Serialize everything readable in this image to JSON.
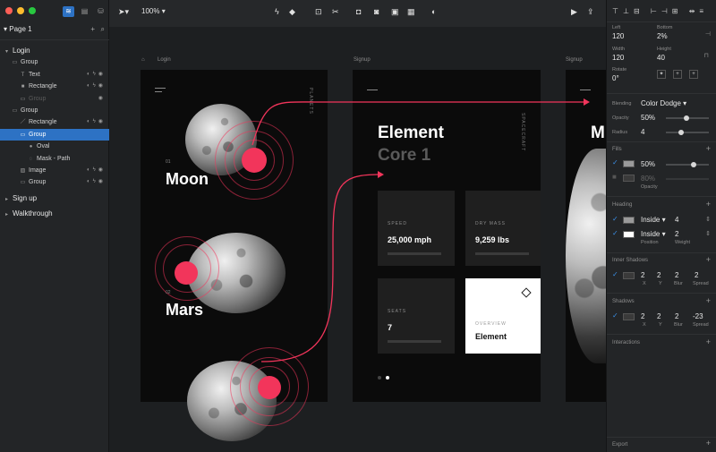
{
  "layers_panel": {
    "page_label": "Page 1",
    "tree": [
      {
        "label": "Login",
        "level": 0,
        "icon": "chevron-down",
        "top": true
      },
      {
        "label": "Group",
        "level": 1,
        "icon": "folder"
      },
      {
        "label": "Text",
        "level": 2,
        "icon": "text",
        "acts": true
      },
      {
        "label": "Rectangle",
        "level": 2,
        "icon": "rect",
        "acts": true
      },
      {
        "label": "Group",
        "level": 2,
        "icon": "folder",
        "dim": true
      },
      {
        "label": "Group",
        "level": 1,
        "icon": "folder"
      },
      {
        "label": "Rectangle",
        "level": 2,
        "icon": "line",
        "acts": true
      },
      {
        "label": "Group",
        "level": 2,
        "icon": "folder",
        "highlight": true
      },
      {
        "label": "Oval",
        "level": 3,
        "icon": "oval"
      },
      {
        "label": "Mask - Path",
        "level": 3,
        "icon": "mask"
      },
      {
        "label": "Image",
        "level": 2,
        "icon": "image",
        "acts": true
      },
      {
        "label": "Group",
        "level": 2,
        "icon": "folder",
        "acts": true
      },
      {
        "label": "Sign up",
        "level": 0,
        "icon": "chevron-right",
        "top": true
      },
      {
        "label": "Walkthrough",
        "level": 0,
        "icon": "chevron-right",
        "top": true
      }
    ]
  },
  "toolbar": {
    "zoom": "100%"
  },
  "canvas": {
    "artboards": [
      {
        "label": "Login"
      },
      {
        "label": "Signup"
      },
      {
        "label": "Signup"
      }
    ],
    "login": {
      "vertical_label": "PLANETS",
      "moon_num": "01",
      "moon": "Moon",
      "mars_num": "02",
      "mars": "Mars"
    },
    "signup": {
      "vertical_label": "SPACECRAFT",
      "title": "Element",
      "subtitle": "Core 1",
      "cards": [
        {
          "label": "SPEED",
          "value": "25,000 mph"
        },
        {
          "label": "DRY MASS",
          "value": "9,259 lbs"
        },
        {
          "label": "SEATS",
          "value": "7"
        },
        {
          "label": "OVERVIEW",
          "value": "Element"
        }
      ]
    },
    "third": {
      "letter": "M"
    }
  },
  "inspector": {
    "left_label": "Left",
    "left": "120",
    "bottom_label": "Bottom",
    "bottom": "2%",
    "width_label": "Width",
    "width": "120",
    "height_label": "Height",
    "height": "40",
    "rotate_label": "Rotate",
    "rotate": "0°",
    "blending_label": "Blending",
    "blending": "Color Dodge",
    "opacity_label": "Opacity",
    "opacity": "50%",
    "radius_label": "Radius",
    "radius": "4",
    "fills_label": "Fills",
    "fill1_opacity": "50%",
    "fill2_opacity": "80%",
    "fill_opacity_label": "Opacity",
    "heading_label": "Heading",
    "heading1_pos": "Inside",
    "heading1_weight": "4",
    "heading2_pos": "Inside",
    "heading2_weight": "2",
    "position_label": "Position",
    "weight_label": "Weight",
    "inner_shadows_label": "Inner Shadows",
    "inner_shadow": {
      "x": "2",
      "y": "2",
      "blur": "2",
      "spread": "2"
    },
    "shadows_label": "Shadows",
    "shadow": {
      "x": "2",
      "y": "2",
      "blur": "2",
      "spread": "-23"
    },
    "x_label": "X",
    "y_label": "Y",
    "blur_label": "Blur",
    "spread_label": "Spread",
    "interactions_label": "Interactions",
    "export_label": "Export"
  },
  "colors": {
    "accent": "#f2355b",
    "selection": "#2d72c4"
  }
}
